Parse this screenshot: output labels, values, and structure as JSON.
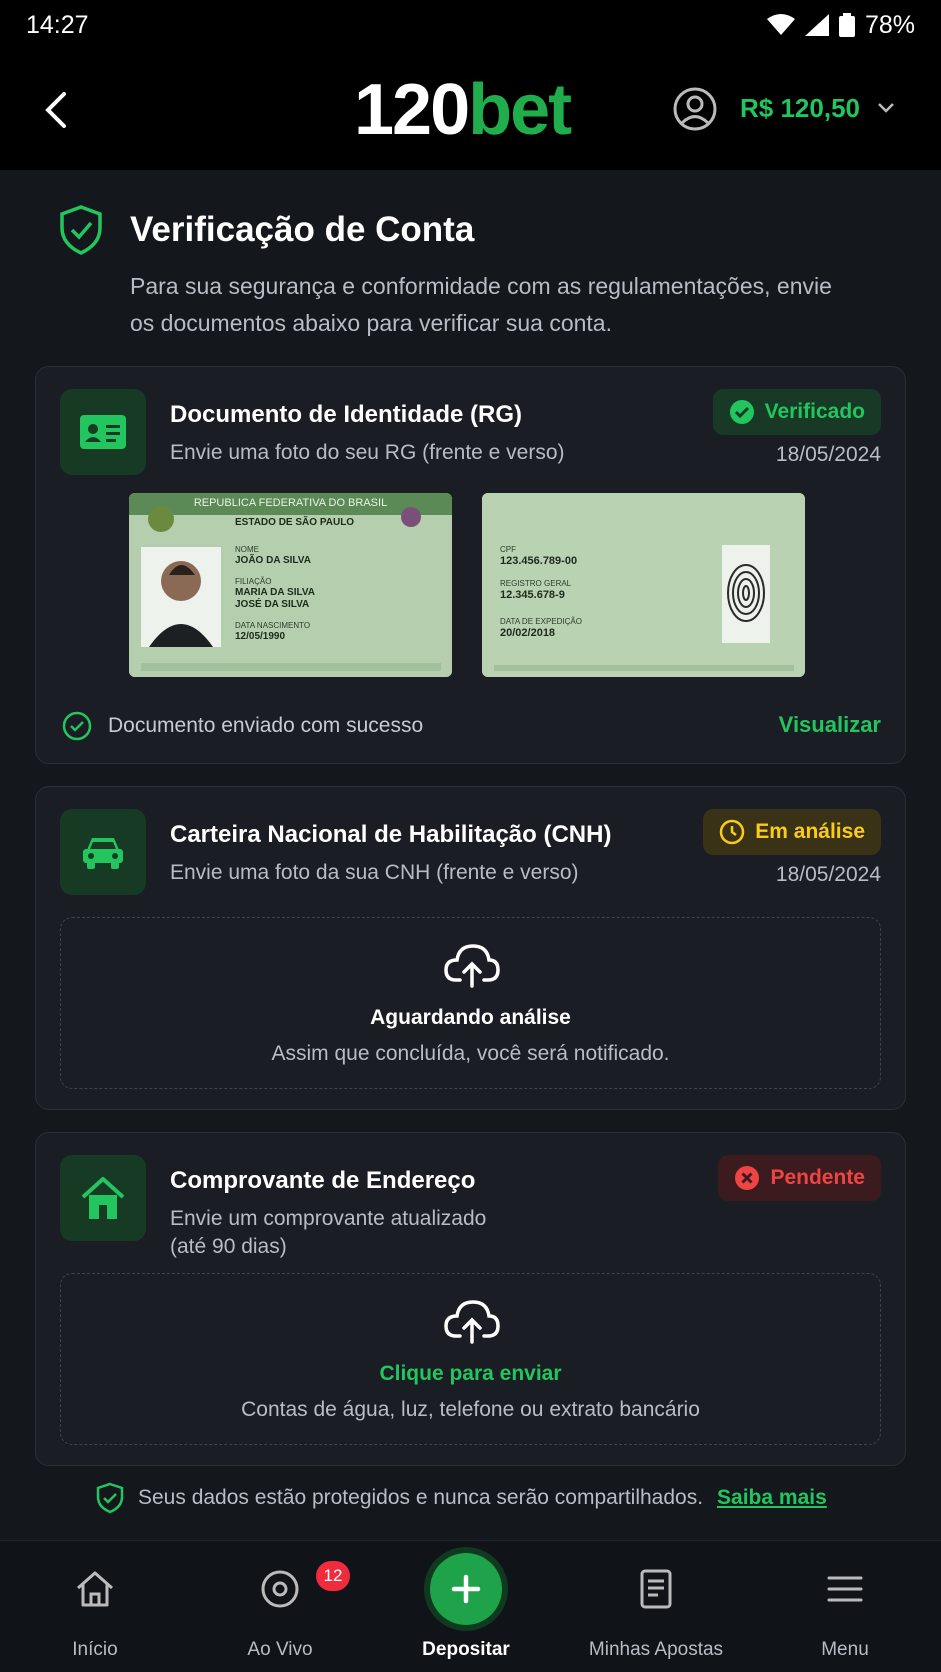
{
  "status_bar": {
    "time": "14:27",
    "battery": "78%"
  },
  "header": {
    "logo_num": "120",
    "logo_bet": "bet",
    "balance": "R$ 120,50"
  },
  "page": {
    "title": "Verificação de Conta",
    "subtitle": "Para sua segurança e conformidade com as regulamentações, envie os documentos abaixo para verificar sua conta."
  },
  "documents": [
    {
      "title": "Documento de Identidade (RG)",
      "description": "Envie uma foto do seu RG (frente e verso)",
      "status": "Verificado",
      "date": "18/05/2024",
      "success_text": "Documento enviado com sucesso",
      "action": "Visualizar",
      "id_front": {
        "header": "REPUBLICA FEDERATIVA DO BRASIL",
        "state": "ESTADO DE SÃO PAULO",
        "name_label": "NOME",
        "name": "JOÃO DA SILVA",
        "filiation_label": "FILIAÇÃO",
        "parent1": "MARIA DA SILVA",
        "parent2": "JOSÉ DA SILVA",
        "birth_label": "DATA NASCIMENTO",
        "birth": "12/05/1990"
      },
      "id_back": {
        "cpf_label": "CPF",
        "cpf": "123.456.789-00",
        "rg_label": "REGISTRO GERAL",
        "rg": "12.345.678-9",
        "issue_label": "DATA DE EXPEDIÇÃO",
        "issue": "20/02/2018"
      }
    },
    {
      "title": "Carteira Nacional de Habilitação (CNH)",
      "description": "Envie uma foto da sua CNH (frente e verso)",
      "status": "Em análise",
      "date": "18/05/2024",
      "box_title": "Aguardando análise",
      "box_sub": "Assim que concluída, você será notificado."
    },
    {
      "title": "Comprovante de Endereço",
      "description_line1": "Envie um comprovante atualizado",
      "description_line2": "(até 90 dias)",
      "status": "Pendente",
      "box_title": "Clique para enviar",
      "box_sub": "Contas de água, luz, telefone ou extrato bancário"
    }
  ],
  "footer_note": {
    "text": "Seus dados estão protegidos e nunca serão compartilhados.",
    "link": "Saiba mais"
  },
  "tabbar": {
    "items": [
      {
        "label": "Início",
        "icon": "home-icon"
      },
      {
        "label": "Ao Vivo",
        "icon": "live-icon",
        "badge": "12"
      },
      {
        "label": "Depositar",
        "icon": "plus-icon"
      },
      {
        "label": "Minhas Apostas",
        "icon": "betslip-icon"
      },
      {
        "label": "Menu",
        "icon": "menu-icon"
      }
    ]
  },
  "colors": {
    "accent": "#22c55e",
    "warning": "#facc15",
    "danger": "#ef4444",
    "background": "#14171c"
  }
}
